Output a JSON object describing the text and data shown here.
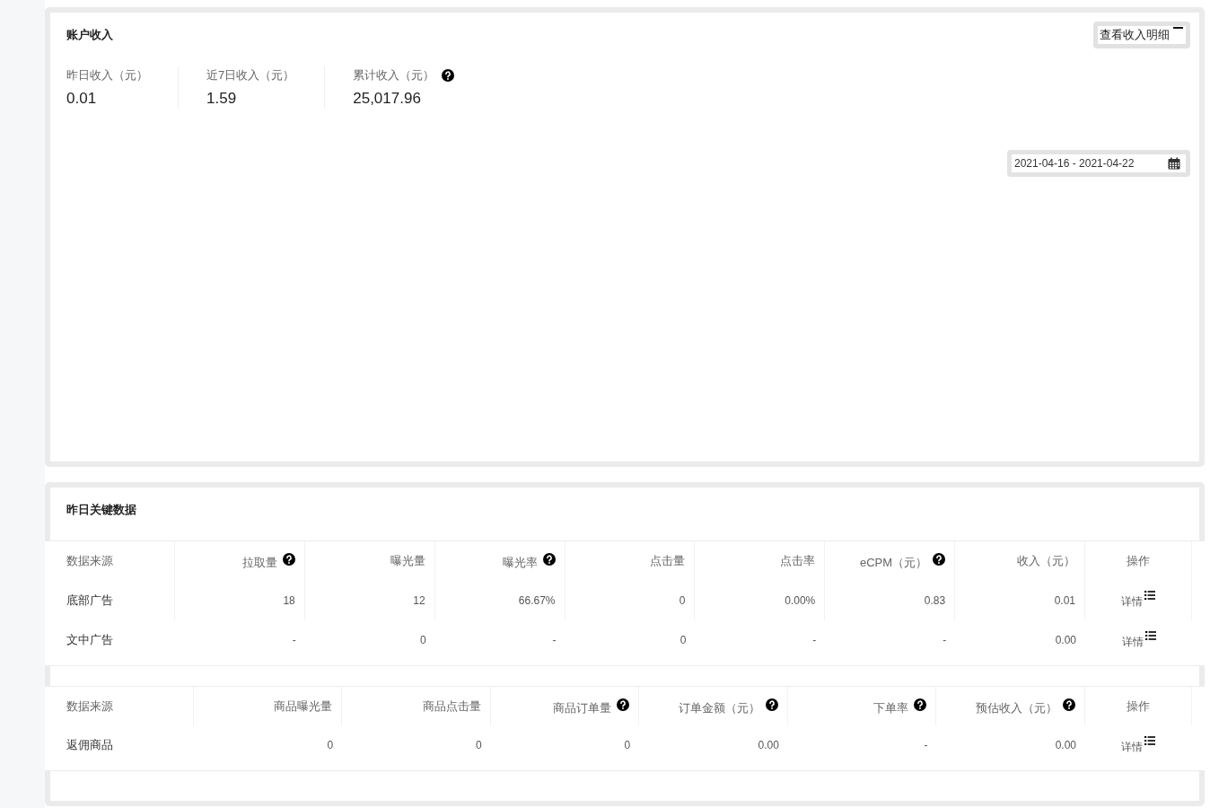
{
  "account_income": {
    "title": "账户收入",
    "detail_button": {
      "label": "查看收入明细"
    },
    "stats": [
      {
        "label": "昨日收入（元）",
        "value": "0.01",
        "help": false
      },
      {
        "label": "近7日收入（元）",
        "value": "1.59",
        "help": false
      },
      {
        "label": "累计收入（元）",
        "value": "25,017.96",
        "help": true
      }
    ],
    "date_range": {
      "value": "2021-04-16 - 2021-04-22"
    }
  },
  "key_data": {
    "title": "昨日关键数据",
    "tables": [
      {
        "columns": [
          {
            "label": "数据来源",
            "help": false
          },
          {
            "label": "拉取量",
            "help": true
          },
          {
            "label": "曝光量",
            "help": false
          },
          {
            "label": "曝光率",
            "help": true
          },
          {
            "label": "点击量",
            "help": false
          },
          {
            "label": "点击率",
            "help": false
          },
          {
            "label": "eCPM（元）",
            "help": true
          },
          {
            "label": "收入（元）",
            "help": false
          },
          {
            "label": "操作",
            "help": false
          }
        ],
        "rows": [
          {
            "cells": [
              "底部广告",
              "18",
              "12",
              "66.67%",
              "0",
              "0.00%",
              "0.83",
              "0.01"
            ],
            "action": "详情"
          },
          {
            "cells": [
              "文中广告",
              "-",
              "0",
              "-",
              "0",
              "-",
              "-",
              "0.00"
            ],
            "action": "详情"
          }
        ]
      },
      {
        "columns": [
          {
            "label": "数据来源",
            "help": false
          },
          {
            "label": "商品曝光量",
            "help": false
          },
          {
            "label": "商品点击量",
            "help": false
          },
          {
            "label": "商品订单量",
            "help": true
          },
          {
            "label": "订单金额（元）",
            "help": true
          },
          {
            "label": "下单率",
            "help": true
          },
          {
            "label": "预估收入（元）",
            "help": true
          },
          {
            "label": "操作",
            "help": false
          }
        ],
        "rows": [
          {
            "cells": [
              "返佣商品",
              "0",
              "0",
              "0",
              "0.00",
              "-",
              "0.00"
            ],
            "action": "详情"
          }
        ]
      }
    ]
  }
}
